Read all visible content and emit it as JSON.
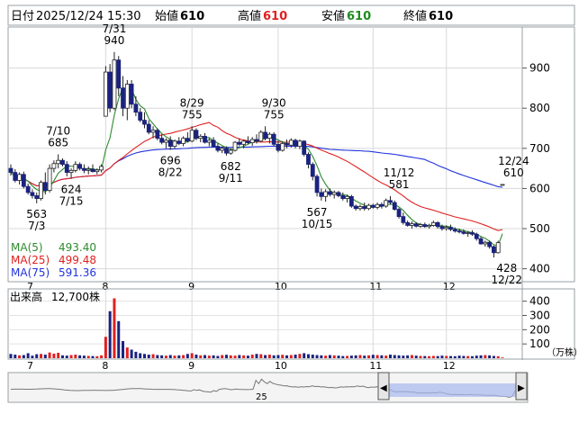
{
  "header": {
    "date_label": "日付",
    "date_value": "2025/12/24 15:30",
    "open_label": "始値",
    "open_value": "610",
    "high_label": "高値",
    "high_value": "610",
    "low_label": "安値",
    "low_value": "610",
    "close_label": "終値",
    "close_value": "610"
  },
  "chart_data": {
    "type": "candlestick",
    "price_axis": {
      "ticks": [
        900,
        800,
        700,
        600,
        500,
        400
      ],
      "range": [
        370,
        1000
      ]
    },
    "volume_axis": {
      "ticks": [
        400,
        300,
        200,
        100
      ],
      "unit": "（万株）",
      "range": [
        0,
        480
      ]
    },
    "month_labels": [
      {
        "label": "7",
        "day": 0
      },
      {
        "label": "8",
        "day": 22
      },
      {
        "label": "9",
        "day": 42
      },
      {
        "label": "10",
        "day": 62
      },
      {
        "label": "11",
        "day": 84
      },
      {
        "label": "12",
        "day": 101
      }
    ],
    "legend": [
      {
        "name": "MA(5)",
        "value": "493.40",
        "color": "#2e8b2e"
      },
      {
        "name": "MA(25)",
        "value": "499.48",
        "color": "#e02020"
      },
      {
        "name": "MA(75)",
        "value": "591.36",
        "color": "#2233dd"
      }
    ],
    "volume_label": "出来高",
    "volume_value": "12,700株",
    "annotations": [
      {
        "date": "7/3",
        "price": "563",
        "day": 6,
        "value": 563,
        "pos": "below"
      },
      {
        "date": "7/10",
        "price": "685",
        "day": 11,
        "value": 685,
        "pos": "above"
      },
      {
        "date": "7/15",
        "price": "624",
        "day": 14,
        "value": 624,
        "pos": "below"
      },
      {
        "date": "7/31",
        "price": "940",
        "day": 24,
        "value": 940,
        "pos": "above"
      },
      {
        "date": "8/22",
        "price": "696",
        "day": 37,
        "value": 696,
        "pos": "below"
      },
      {
        "date": "8/29",
        "price": "755",
        "day": 42,
        "value": 755,
        "pos": "above"
      },
      {
        "date": "9/11",
        "price": "682",
        "day": 51,
        "value": 682,
        "pos": "below"
      },
      {
        "date": "9/30",
        "price": "755",
        "day": 61,
        "value": 755,
        "pos": "above"
      },
      {
        "date": "10/15",
        "price": "567",
        "day": 71,
        "value": 567,
        "pos": "below"
      },
      {
        "date": "11/12",
        "price": "581",
        "day": 90,
        "value": 581,
        "pos": "above"
      },
      {
        "date": "12/22",
        "price": "428",
        "day": 115,
        "value": 428,
        "pos": "below"
      },
      {
        "date": "12/24",
        "price": "610",
        "day": 117,
        "value": 610,
        "pos": "above-left"
      }
    ],
    "candles": [
      {
        "o": 650,
        "h": 660,
        "l": 632,
        "c": 640
      },
      {
        "o": 640,
        "h": 648,
        "l": 615,
        "c": 620
      },
      {
        "o": 620,
        "h": 640,
        "l": 610,
        "c": 635
      },
      {
        "o": 635,
        "h": 642,
        "l": 600,
        "c": 605
      },
      {
        "o": 605,
        "h": 612,
        "l": 585,
        "c": 590
      },
      {
        "o": 590,
        "h": 598,
        "l": 575,
        "c": 582
      },
      {
        "o": 582,
        "h": 590,
        "l": 563,
        "c": 575
      },
      {
        "o": 575,
        "h": 620,
        "l": 570,
        "c": 615
      },
      {
        "o": 615,
        "h": 640,
        "l": 585,
        "c": 595
      },
      {
        "o": 595,
        "h": 660,
        "l": 590,
        "c": 650
      },
      {
        "o": 650,
        "h": 670,
        "l": 640,
        "c": 662
      },
      {
        "o": 662,
        "h": 685,
        "l": 650,
        "c": 670
      },
      {
        "o": 670,
        "h": 675,
        "l": 655,
        "c": 660
      },
      {
        "o": 660,
        "h": 668,
        "l": 630,
        "c": 640
      },
      {
        "o": 640,
        "h": 650,
        "l": 624,
        "c": 645
      },
      {
        "o": 645,
        "h": 668,
        "l": 640,
        "c": 660
      },
      {
        "o": 660,
        "h": 665,
        "l": 645,
        "c": 650
      },
      {
        "o": 650,
        "h": 660,
        "l": 638,
        "c": 645
      },
      {
        "o": 645,
        "h": 655,
        "l": 635,
        "c": 648
      },
      {
        "o": 648,
        "h": 660,
        "l": 640,
        "c": 642
      },
      {
        "o": 642,
        "h": 650,
        "l": 635,
        "c": 646
      },
      {
        "o": 646,
        "h": 660,
        "l": 640,
        "c": 655
      },
      {
        "o": 780,
        "h": 905,
        "l": 780,
        "c": 890
      },
      {
        "o": 890,
        "h": 910,
        "l": 790,
        "c": 800
      },
      {
        "o": 800,
        "h": 940,
        "l": 795,
        "c": 920
      },
      {
        "o": 920,
        "h": 930,
        "l": 830,
        "c": 850
      },
      {
        "o": 850,
        "h": 880,
        "l": 780,
        "c": 800
      },
      {
        "o": 800,
        "h": 870,
        "l": 770,
        "c": 860
      },
      {
        "o": 860,
        "h": 870,
        "l": 800,
        "c": 810
      },
      {
        "o": 810,
        "h": 830,
        "l": 780,
        "c": 790
      },
      {
        "o": 790,
        "h": 800,
        "l": 765,
        "c": 770
      },
      {
        "o": 770,
        "h": 790,
        "l": 750,
        "c": 760
      },
      {
        "o": 760,
        "h": 770,
        "l": 735,
        "c": 740
      },
      {
        "o": 740,
        "h": 755,
        "l": 725,
        "c": 745
      },
      {
        "o": 745,
        "h": 750,
        "l": 720,
        "c": 725
      },
      {
        "o": 725,
        "h": 735,
        "l": 710,
        "c": 715
      },
      {
        "o": 715,
        "h": 725,
        "l": 700,
        "c": 720
      },
      {
        "o": 720,
        "h": 730,
        "l": 696,
        "c": 705
      },
      {
        "o": 705,
        "h": 722,
        "l": 700,
        "c": 718
      },
      {
        "o": 718,
        "h": 728,
        "l": 708,
        "c": 712
      },
      {
        "o": 712,
        "h": 730,
        "l": 705,
        "c": 725
      },
      {
        "o": 725,
        "h": 740,
        "l": 715,
        "c": 718
      },
      {
        "o": 718,
        "h": 755,
        "l": 715,
        "c": 745
      },
      {
        "o": 745,
        "h": 750,
        "l": 720,
        "c": 725
      },
      {
        "o": 725,
        "h": 735,
        "l": 715,
        "c": 730
      },
      {
        "o": 730,
        "h": 738,
        "l": 712,
        "c": 715
      },
      {
        "o": 715,
        "h": 725,
        "l": 705,
        "c": 720
      },
      {
        "o": 720,
        "h": 728,
        "l": 702,
        "c": 705
      },
      {
        "o": 705,
        "h": 712,
        "l": 690,
        "c": 695
      },
      {
        "o": 695,
        "h": 705,
        "l": 688,
        "c": 700
      },
      {
        "o": 700,
        "h": 705,
        "l": 682,
        "c": 688
      },
      {
        "o": 688,
        "h": 700,
        "l": 684,
        "c": 695
      },
      {
        "o": 695,
        "h": 718,
        "l": 692,
        "c": 715
      },
      {
        "o": 715,
        "h": 725,
        "l": 705,
        "c": 710
      },
      {
        "o": 710,
        "h": 722,
        "l": 700,
        "c": 718
      },
      {
        "o": 718,
        "h": 730,
        "l": 710,
        "c": 714
      },
      {
        "o": 714,
        "h": 728,
        "l": 706,
        "c": 722
      },
      {
        "o": 722,
        "h": 735,
        "l": 712,
        "c": 718
      },
      {
        "o": 718,
        "h": 745,
        "l": 715,
        "c": 740
      },
      {
        "o": 740,
        "h": 755,
        "l": 720,
        "c": 725
      },
      {
        "o": 725,
        "h": 740,
        "l": 712,
        "c": 735
      },
      {
        "o": 735,
        "h": 740,
        "l": 705,
        "c": 710
      },
      {
        "o": 710,
        "h": 720,
        "l": 690,
        "c": 695
      },
      {
        "o": 695,
        "h": 718,
        "l": 692,
        "c": 712
      },
      {
        "o": 712,
        "h": 722,
        "l": 700,
        "c": 708
      },
      {
        "o": 708,
        "h": 725,
        "l": 702,
        "c": 720
      },
      {
        "o": 720,
        "h": 724,
        "l": 700,
        "c": 705
      },
      {
        "o": 705,
        "h": 722,
        "l": 698,
        "c": 718
      },
      {
        "o": 718,
        "h": 720,
        "l": 680,
        "c": 685
      },
      {
        "o": 685,
        "h": 690,
        "l": 650,
        "c": 660
      },
      {
        "o": 660,
        "h": 665,
        "l": 620,
        "c": 630
      },
      {
        "o": 630,
        "h": 635,
        "l": 580,
        "c": 590
      },
      {
        "o": 590,
        "h": 600,
        "l": 570,
        "c": 580
      },
      {
        "o": 580,
        "h": 598,
        "l": 567,
        "c": 592
      },
      {
        "o": 592,
        "h": 600,
        "l": 580,
        "c": 585
      },
      {
        "o": 585,
        "h": 595,
        "l": 575,
        "c": 590
      },
      {
        "o": 590,
        "h": 594,
        "l": 578,
        "c": 582
      },
      {
        "o": 582,
        "h": 590,
        "l": 570,
        "c": 575
      },
      {
        "o": 575,
        "h": 585,
        "l": 565,
        "c": 580
      },
      {
        "o": 580,
        "h": 584,
        "l": 552,
        "c": 556
      },
      {
        "o": 556,
        "h": 560,
        "l": 545,
        "c": 550
      },
      {
        "o": 550,
        "h": 560,
        "l": 545,
        "c": 555
      },
      {
        "o": 555,
        "h": 565,
        "l": 545,
        "c": 550
      },
      {
        "o": 550,
        "h": 562,
        "l": 546,
        "c": 558
      },
      {
        "o": 558,
        "h": 562,
        "l": 550,
        "c": 553
      },
      {
        "o": 553,
        "h": 565,
        "l": 548,
        "c": 560
      },
      {
        "o": 560,
        "h": 565,
        "l": 550,
        "c": 556
      },
      {
        "o": 556,
        "h": 575,
        "l": 552,
        "c": 570
      },
      {
        "o": 570,
        "h": 581,
        "l": 560,
        "c": 565
      },
      {
        "o": 565,
        "h": 570,
        "l": 545,
        "c": 548
      },
      {
        "o": 548,
        "h": 552,
        "l": 525,
        "c": 530
      },
      {
        "o": 530,
        "h": 540,
        "l": 510,
        "c": 515
      },
      {
        "o": 515,
        "h": 520,
        "l": 505,
        "c": 508
      },
      {
        "o": 508,
        "h": 518,
        "l": 500,
        "c": 512
      },
      {
        "o": 512,
        "h": 516,
        "l": 503,
        "c": 506
      },
      {
        "o": 506,
        "h": 514,
        "l": 502,
        "c": 510
      },
      {
        "o": 510,
        "h": 515,
        "l": 502,
        "c": 505
      },
      {
        "o": 505,
        "h": 512,
        "l": 500,
        "c": 508
      },
      {
        "o": 508,
        "h": 520,
        "l": 505,
        "c": 515
      },
      {
        "o": 515,
        "h": 518,
        "l": 500,
        "c": 505
      },
      {
        "o": 505,
        "h": 510,
        "l": 495,
        "c": 500
      },
      {
        "o": 500,
        "h": 508,
        "l": 495,
        "c": 503
      },
      {
        "o": 503,
        "h": 510,
        "l": 494,
        "c": 498
      },
      {
        "o": 498,
        "h": 503,
        "l": 490,
        "c": 494
      },
      {
        "o": 494,
        "h": 500,
        "l": 488,
        "c": 492
      },
      {
        "o": 492,
        "h": 498,
        "l": 485,
        "c": 488
      },
      {
        "o": 488,
        "h": 494,
        "l": 480,
        "c": 490
      },
      {
        "o": 490,
        "h": 496,
        "l": 482,
        "c": 486
      },
      {
        "o": 486,
        "h": 490,
        "l": 470,
        "c": 475
      },
      {
        "o": 475,
        "h": 480,
        "l": 460,
        "c": 462
      },
      {
        "o": 462,
        "h": 470,
        "l": 455,
        "c": 466
      },
      {
        "o": 466,
        "h": 470,
        "l": 450,
        "c": 455
      },
      {
        "o": 455,
        "h": 458,
        "l": 428,
        "c": 440
      },
      {
        "o": 440,
        "h": 470,
        "l": 438,
        "c": 465
      },
      {
        "o": 610,
        "h": 610,
        "l": 610,
        "c": 610
      }
    ],
    "volumes": [
      30,
      25,
      20,
      22,
      35,
      18,
      28,
      30,
      25,
      40,
      32,
      38,
      20,
      18,
      22,
      25,
      20,
      18,
      16,
      15,
      14,
      20,
      150,
      330,
      420,
      260,
      120,
      75,
      60,
      45,
      35,
      30,
      25,
      28,
      22,
      20,
      18,
      22,
      18,
      20,
      22,
      30,
      35,
      25,
      20,
      22,
      18,
      20,
      16,
      22,
      24,
      20,
      18,
      22,
      20,
      18,
      25,
      30,
      28,
      22,
      25,
      20,
      22,
      24,
      20,
      22,
      25,
      30,
      35,
      28,
      25,
      22,
      20,
      18,
      22,
      20,
      18,
      15,
      16,
      18,
      20,
      22,
      18,
      20,
      24,
      22,
      20,
      18,
      25,
      22,
      20,
      18,
      20,
      22,
      18,
      16,
      15,
      14,
      16,
      15,
      18,
      16,
      15,
      14,
      18,
      16,
      15,
      14,
      18,
      20,
      22,
      20,
      16,
      14,
      5
    ],
    "scrollbar_label": "25"
  }
}
